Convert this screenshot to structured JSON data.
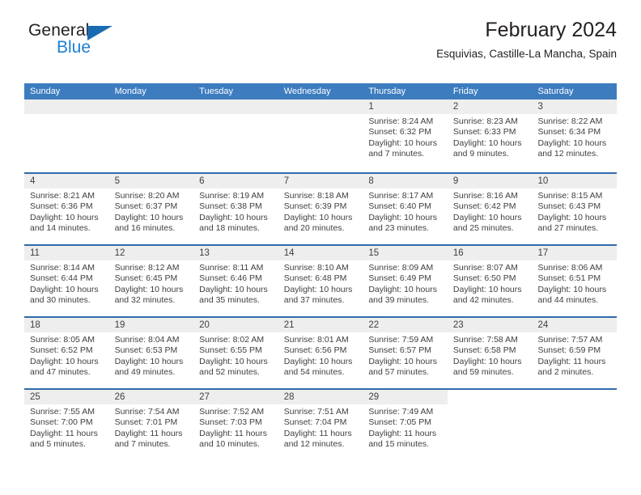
{
  "logo": {
    "word_top": "General",
    "word_bottom": "Blue",
    "triangle_icon": "blue-triangle-icon"
  },
  "header": {
    "title": "February 2024",
    "subtitle": "Esquivias, Castille-La Mancha, Spain"
  },
  "colors": {
    "header_blue": "#3c7cbf",
    "rule_blue": "#2f6cac",
    "daynum_band": "#eeeeee",
    "logo_blue": "#1b7fd4",
    "text": "#3f3f3f"
  },
  "weekdays": [
    "Sunday",
    "Monday",
    "Tuesday",
    "Wednesday",
    "Thursday",
    "Friday",
    "Saturday"
  ],
  "labels": {
    "sunrise_prefix": "Sunrise:",
    "sunset_prefix": "Sunset:",
    "daylight_prefix": "Daylight:"
  },
  "weeks": [
    [
      {
        "day": "",
        "lines": []
      },
      {
        "day": "",
        "lines": []
      },
      {
        "day": "",
        "lines": []
      },
      {
        "day": "",
        "lines": []
      },
      {
        "day": "1",
        "lines": [
          "Sunrise: 8:24 AM",
          "Sunset: 6:32 PM",
          "Daylight: 10 hours",
          "and 7 minutes."
        ]
      },
      {
        "day": "2",
        "lines": [
          "Sunrise: 8:23 AM",
          "Sunset: 6:33 PM",
          "Daylight: 10 hours",
          "and 9 minutes."
        ]
      },
      {
        "day": "3",
        "lines": [
          "Sunrise: 8:22 AM",
          "Sunset: 6:34 PM",
          "Daylight: 10 hours",
          "and 12 minutes."
        ]
      }
    ],
    [
      {
        "day": "4",
        "lines": [
          "Sunrise: 8:21 AM",
          "Sunset: 6:36 PM",
          "Daylight: 10 hours",
          "and 14 minutes."
        ]
      },
      {
        "day": "5",
        "lines": [
          "Sunrise: 8:20 AM",
          "Sunset: 6:37 PM",
          "Daylight: 10 hours",
          "and 16 minutes."
        ]
      },
      {
        "day": "6",
        "lines": [
          "Sunrise: 8:19 AM",
          "Sunset: 6:38 PM",
          "Daylight: 10 hours",
          "and 18 minutes."
        ]
      },
      {
        "day": "7",
        "lines": [
          "Sunrise: 8:18 AM",
          "Sunset: 6:39 PM",
          "Daylight: 10 hours",
          "and 20 minutes."
        ]
      },
      {
        "day": "8",
        "lines": [
          "Sunrise: 8:17 AM",
          "Sunset: 6:40 PM",
          "Daylight: 10 hours",
          "and 23 minutes."
        ]
      },
      {
        "day": "9",
        "lines": [
          "Sunrise: 8:16 AM",
          "Sunset: 6:42 PM",
          "Daylight: 10 hours",
          "and 25 minutes."
        ]
      },
      {
        "day": "10",
        "lines": [
          "Sunrise: 8:15 AM",
          "Sunset: 6:43 PM",
          "Daylight: 10 hours",
          "and 27 minutes."
        ]
      }
    ],
    [
      {
        "day": "11",
        "lines": [
          "Sunrise: 8:14 AM",
          "Sunset: 6:44 PM",
          "Daylight: 10 hours",
          "and 30 minutes."
        ]
      },
      {
        "day": "12",
        "lines": [
          "Sunrise: 8:12 AM",
          "Sunset: 6:45 PM",
          "Daylight: 10 hours",
          "and 32 minutes."
        ]
      },
      {
        "day": "13",
        "lines": [
          "Sunrise: 8:11 AM",
          "Sunset: 6:46 PM",
          "Daylight: 10 hours",
          "and 35 minutes."
        ]
      },
      {
        "day": "14",
        "lines": [
          "Sunrise: 8:10 AM",
          "Sunset: 6:48 PM",
          "Daylight: 10 hours",
          "and 37 minutes."
        ]
      },
      {
        "day": "15",
        "lines": [
          "Sunrise: 8:09 AM",
          "Sunset: 6:49 PM",
          "Daylight: 10 hours",
          "and 39 minutes."
        ]
      },
      {
        "day": "16",
        "lines": [
          "Sunrise: 8:07 AM",
          "Sunset: 6:50 PM",
          "Daylight: 10 hours",
          "and 42 minutes."
        ]
      },
      {
        "day": "17",
        "lines": [
          "Sunrise: 8:06 AM",
          "Sunset: 6:51 PM",
          "Daylight: 10 hours",
          "and 44 minutes."
        ]
      }
    ],
    [
      {
        "day": "18",
        "lines": [
          "Sunrise: 8:05 AM",
          "Sunset: 6:52 PM",
          "Daylight: 10 hours",
          "and 47 minutes."
        ]
      },
      {
        "day": "19",
        "lines": [
          "Sunrise: 8:04 AM",
          "Sunset: 6:53 PM",
          "Daylight: 10 hours",
          "and 49 minutes."
        ]
      },
      {
        "day": "20",
        "lines": [
          "Sunrise: 8:02 AM",
          "Sunset: 6:55 PM",
          "Daylight: 10 hours",
          "and 52 minutes."
        ]
      },
      {
        "day": "21",
        "lines": [
          "Sunrise: 8:01 AM",
          "Sunset: 6:56 PM",
          "Daylight: 10 hours",
          "and 54 minutes."
        ]
      },
      {
        "day": "22",
        "lines": [
          "Sunrise: 7:59 AM",
          "Sunset: 6:57 PM",
          "Daylight: 10 hours",
          "and 57 minutes."
        ]
      },
      {
        "day": "23",
        "lines": [
          "Sunrise: 7:58 AM",
          "Sunset: 6:58 PM",
          "Daylight: 10 hours",
          "and 59 minutes."
        ]
      },
      {
        "day": "24",
        "lines": [
          "Sunrise: 7:57 AM",
          "Sunset: 6:59 PM",
          "Daylight: 11 hours",
          "and 2 minutes."
        ]
      }
    ],
    [
      {
        "day": "25",
        "lines": [
          "Sunrise: 7:55 AM",
          "Sunset: 7:00 PM",
          "Daylight: 11 hours",
          "and 5 minutes."
        ]
      },
      {
        "day": "26",
        "lines": [
          "Sunrise: 7:54 AM",
          "Sunset: 7:01 PM",
          "Daylight: 11 hours",
          "and 7 minutes."
        ]
      },
      {
        "day": "27",
        "lines": [
          "Sunrise: 7:52 AM",
          "Sunset: 7:03 PM",
          "Daylight: 11 hours",
          "and 10 minutes."
        ]
      },
      {
        "day": "28",
        "lines": [
          "Sunrise: 7:51 AM",
          "Sunset: 7:04 PM",
          "Daylight: 11 hours",
          "and 12 minutes."
        ]
      },
      {
        "day": "29",
        "lines": [
          "Sunrise: 7:49 AM",
          "Sunset: 7:05 PM",
          "Daylight: 11 hours",
          "and 15 minutes."
        ]
      },
      {
        "day": "",
        "lines": []
      },
      {
        "day": "",
        "lines": []
      }
    ]
  ]
}
